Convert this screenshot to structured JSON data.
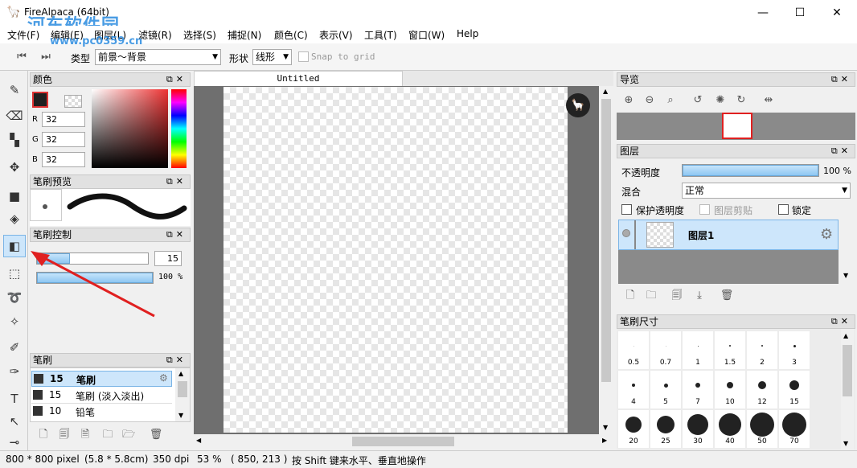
{
  "window": {
    "title": "FireAlpaca (64bit)",
    "watermark": "河东软件园",
    "watermark_url": "www.pc0359.cn",
    "minimize": "—",
    "maximize": "☐",
    "close": "✕"
  },
  "menu": [
    "文件(F)",
    "编辑(E)",
    "图层(L)",
    "滤镜(R)",
    "选择(S)",
    "捕捉(N)",
    "颜色(C)",
    "表示(V)",
    "工具(T)",
    "窗口(W)",
    "Help"
  ],
  "toolbar": {
    "type_label": "类型",
    "type_value": "前景～背景",
    "shape_label": "形状",
    "shape_value": "线形",
    "snap_label": "Snap to grid"
  },
  "color_panel": {
    "title": "颜色",
    "r_label": "R",
    "r_value": "32",
    "g_label": "G",
    "g_value": "32",
    "b_label": "B",
    "b_value": "32",
    "foreground": "#202020"
  },
  "brush_preview_panel": {
    "title": "笔刷预览"
  },
  "brush_control_panel": {
    "title": "笔刷控制",
    "size_value": "15",
    "opacity_value": "100 %",
    "size_fraction": 0.3,
    "opacity_fraction": 1.0
  },
  "brush_panel": {
    "title": "笔刷",
    "items": [
      {
        "size": "15",
        "name": "笔刷"
      },
      {
        "size": "15",
        "name": "笔刷 (淡入淡出)"
      },
      {
        "size": "10",
        "name": "铅笔"
      }
    ]
  },
  "document": {
    "tab": "Untitled"
  },
  "navigator_panel": {
    "title": "导览"
  },
  "layer_panel": {
    "title": "图层",
    "opacity_label": "不透明度",
    "opacity_value": "100 %",
    "opacity_fraction": 1.0,
    "blend_label": "混合",
    "blend_value": "正常",
    "protect_alpha": "保护透明度",
    "clipping": "图层剪贴",
    "lock": "锁定",
    "layers": [
      {
        "name": "图层1"
      }
    ]
  },
  "brush_size_panel": {
    "title": "笔刷尺寸",
    "sizes": [
      "0.5",
      "0.7",
      "1",
      "1.5",
      "2",
      "3",
      "4",
      "5",
      "7",
      "10",
      "12",
      "15",
      "20",
      "25",
      "30",
      "40",
      "50",
      "70"
    ]
  },
  "status": {
    "pixels": "800 * 800 pixel",
    "cm": "(5.8 * 5.8cm)",
    "dpi": "350 dpi",
    "zoom": "53 %",
    "coords": "( 850, 213 )",
    "hint": "按 Shift 键来水平、垂直地操作"
  }
}
